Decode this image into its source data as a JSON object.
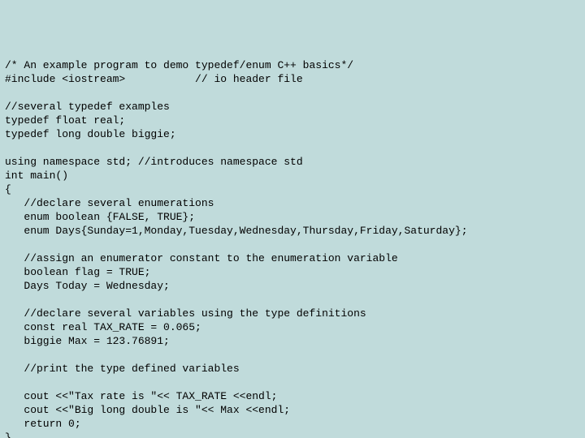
{
  "code": {
    "l01": "/* An example program to demo typedef/enum C++ basics*/",
    "l02": "#include <iostream>           // io header file",
    "l03": "",
    "l04": "//several typedef examples",
    "l05": "typedef float real;",
    "l06": "typedef long double biggie;",
    "l07": "",
    "l08": "using namespace std; //introduces namespace std",
    "l09": "int main()",
    "l10": "{",
    "l11": "   //declare several enumerations",
    "l12": "   enum boolean {FALSE, TRUE};",
    "l13": "   enum Days{Sunday=1,Monday,Tuesday,Wednesday,Thursday,Friday,Saturday};",
    "l14": "",
    "l15": "   //assign an enumerator constant to the enumeration variable",
    "l16": "   boolean flag = TRUE;",
    "l17": "   Days Today = Wednesday;",
    "l18": "",
    "l19": "   //declare several variables using the type definitions",
    "l20": "   const real TAX_RATE = 0.065;",
    "l21": "   biggie Max = 123.76891;",
    "l22": "",
    "l23": "   //print the type defined variables",
    "l24": "",
    "l25": "   cout <<\"Tax rate is \"<< TAX_RATE <<endl;",
    "l26": "   cout <<\"Big long double is \"<< Max <<endl;",
    "l27": "   return 0;",
    "l28": "}"
  }
}
